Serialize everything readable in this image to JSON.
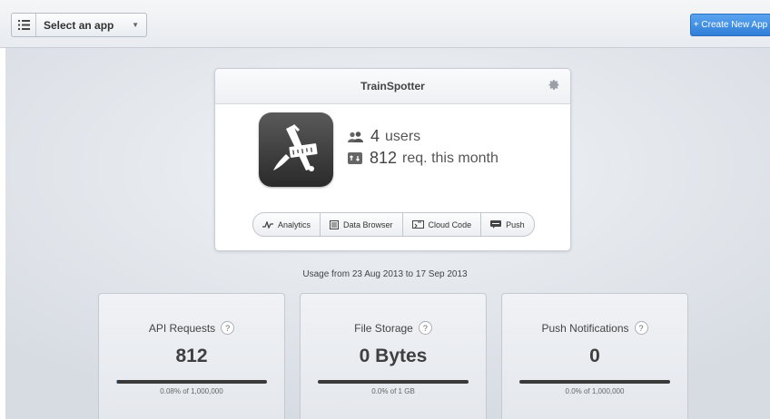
{
  "topbar": {
    "app_select_label": "Select an app",
    "create_button_label": "+ Create New App"
  },
  "app": {
    "name": "TrainSpotter",
    "users_count": "4",
    "users_label": "users",
    "requests_count": "812",
    "requests_label": "req. this month",
    "tabs": [
      {
        "label": "Analytics",
        "icon": "analytics-icon"
      },
      {
        "label": "Data Browser",
        "icon": "data-browser-icon"
      },
      {
        "label": "Cloud Code",
        "icon": "cloud-code-icon"
      },
      {
        "label": "Push",
        "icon": "push-icon"
      }
    ]
  },
  "usage_range": "Usage from 23 Aug 2013 to 17 Sep 2013",
  "stats": [
    {
      "label": "API Requests",
      "value": "812",
      "sub": "0.08% of 1,000,000",
      "fill_fraction": 0.0008
    },
    {
      "label": "File Storage",
      "value": "0 Bytes",
      "sub": "0.0% of 1 GB",
      "fill_fraction": 0
    },
    {
      "label": "Push Notifications",
      "value": "0",
      "sub": "0.0% of 1,000,000",
      "fill_fraction": 0
    }
  ],
  "help_glyph": "?",
  "colors": {
    "accent": "#3a8ae6",
    "bar_track": "#3a3a3a"
  }
}
